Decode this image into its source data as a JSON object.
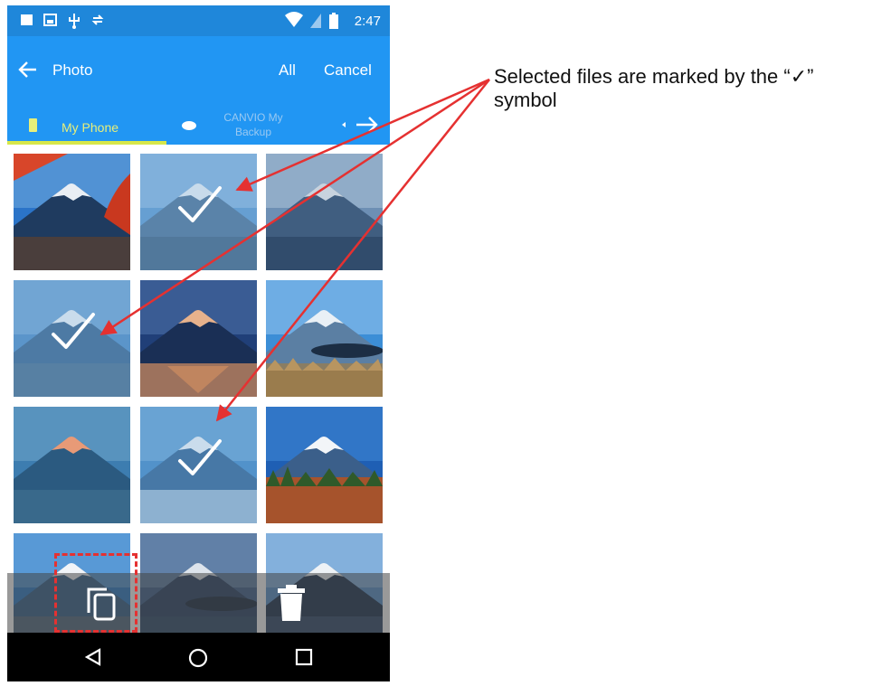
{
  "status_bar": {
    "time": "2:47"
  },
  "app_bar": {
    "title": "Photo",
    "all_label": "All",
    "cancel_label": "Cancel"
  },
  "tabs": [
    {
      "label": "My Phone"
    },
    {
      "label": "CANVIO My Backup"
    }
  ],
  "photos": [
    {
      "name": "red-leaves-mountain",
      "selected": false
    },
    {
      "name": "snow-peak",
      "selected": true
    },
    {
      "name": "misty-lake",
      "selected": false
    },
    {
      "name": "snow-peak-close",
      "selected": true
    },
    {
      "name": "reflection-sunset",
      "selected": false
    },
    {
      "name": "lake-reeds",
      "selected": false
    },
    {
      "name": "pink-peak",
      "selected": false
    },
    {
      "name": "winter-lake",
      "selected": true
    },
    {
      "name": "autumn-forest",
      "selected": false
    },
    {
      "name": "peak-bottom-left",
      "selected": false
    },
    {
      "name": "lake-shore",
      "selected": false
    },
    {
      "name": "dark-lake",
      "selected": false
    }
  ],
  "actions": {
    "copy_icon": "copy-icon",
    "delete_icon": "trash-icon"
  },
  "nav": {
    "back_icon": "back-triangle-icon",
    "home_icon": "home-circle-icon",
    "recents_icon": "recents-square-icon"
  },
  "annotation": {
    "text": "Selected files are marked by the “✓” symbol"
  },
  "colors": {
    "status_bar": "#1f87da",
    "app_bar": "#2196f3",
    "tab_accent": "#d7e74a",
    "annotation_arrow": "#e53131"
  }
}
